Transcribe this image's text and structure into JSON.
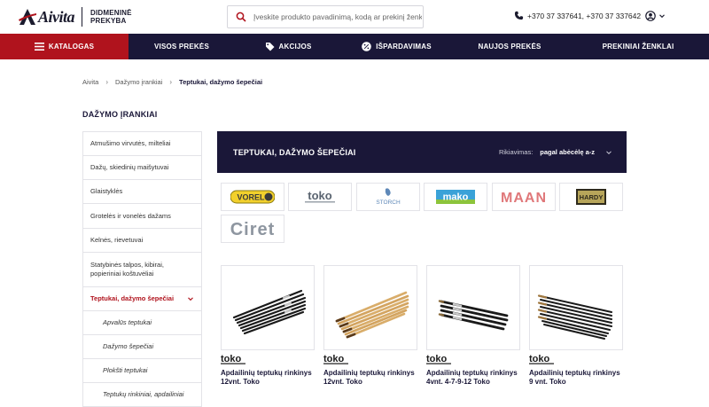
{
  "header": {
    "logo_name": "Aivita",
    "logo_tag_line1": "DIDMENINĖ",
    "logo_tag_line2": "PREKYBA",
    "search_placeholder": "Įveskite produkto pavadinimą, kodą ar prekinį ženklą",
    "phone": "+370 37 337641, +370 37 337642"
  },
  "nav": {
    "items": [
      {
        "label": "KATALOGAS",
        "icon": "hamburger-icon",
        "active": true
      },
      {
        "label": "VISOS PREKĖS"
      },
      {
        "label": "AKCIJOS",
        "icon": "tag-icon"
      },
      {
        "label": "IŠPARDAVIMAS",
        "icon": "percent-icon"
      },
      {
        "label": "NAUJOS PREKĖS"
      },
      {
        "label": "PREKINIAI ŽENKLAI"
      }
    ]
  },
  "breadcrumb": {
    "items": [
      "Aivita",
      "Dažymo įrankiai"
    ],
    "current": "Teptukai, dažymo šepečiai"
  },
  "sidebar": {
    "title": "DAŽYMO ĮRANKIAI",
    "items": [
      {
        "label": "Atmušimo virvutės, milteliai"
      },
      {
        "label": "Dažų, skiedinių maišytuvai"
      },
      {
        "label": "Glaistyklės"
      },
      {
        "label": "Grotelės ir vonelės dažams"
      },
      {
        "label": "Kelnės, rievetuvai"
      },
      {
        "label": "Statybinės talpos, kibirai, popieriniai koštuvėliai"
      },
      {
        "label": "Teptukai, dažymo šepečiai"
      },
      {
        "label": "Apvalūs teptukai"
      },
      {
        "label": "Dažymo šepečiai"
      },
      {
        "label": "Plokšti teptukai"
      },
      {
        "label": "Teptukų rinkiniai, apdailiniai"
      }
    ]
  },
  "category": {
    "title": "TEPTUKAI, DAŽYMO ŠEPEČIAI",
    "sort_label": "Rikiavimas:",
    "sort_value": "pagal abėcėlę a-z"
  },
  "brands": [
    {
      "name": "VOREL"
    },
    {
      "name": "toko"
    },
    {
      "name": "STORCH"
    },
    {
      "name": "mako"
    },
    {
      "name": "MAAN"
    },
    {
      "name": "HARDY"
    },
    {
      "name": "Ciret"
    }
  ],
  "products": [
    {
      "brand": "toko",
      "name": "Apdailinių teptukų rinkinys 12vnt. Toko"
    },
    {
      "brand": "toko",
      "name": "Apdailinių teptukų rinkinys 12vnt. Toko"
    },
    {
      "brand": "toko",
      "name": "Apdailinių teptukų rinkinys 4vnt. 4-7-9-12 Toko"
    },
    {
      "brand": "toko",
      "name": "Apdailinių teptukų rinkinys 9 vnt. Toko"
    }
  ],
  "colors": {
    "navy": "#1a1738",
    "accent_red": "#b0131d"
  }
}
